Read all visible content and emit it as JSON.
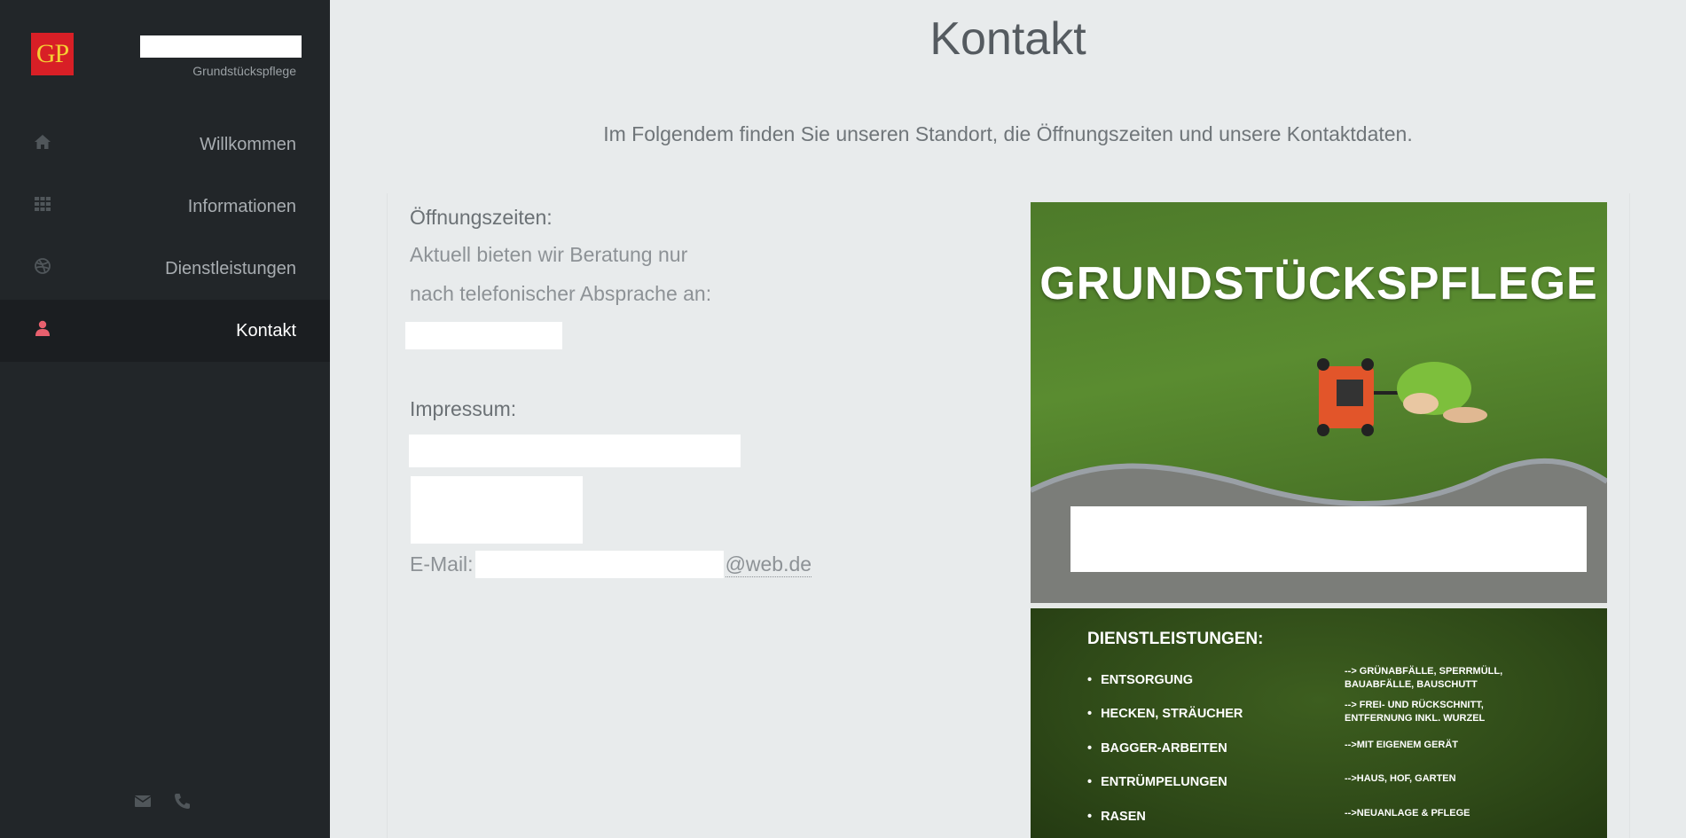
{
  "brand": {
    "logo_text": "GP",
    "subtitle": "Grundstückspflege"
  },
  "nav": [
    {
      "label": "Willkommen",
      "icon": "home-icon"
    },
    {
      "label": "Informationen",
      "icon": "grid-icon"
    },
    {
      "label": "Dienstleistungen",
      "icon": "dribbble-icon"
    },
    {
      "label": "Kontakt",
      "icon": "user-icon",
      "active": true
    }
  ],
  "footer_icons": [
    "envelope-icon",
    "phone-icon"
  ],
  "page": {
    "title": "Kontakt",
    "intro": "Im Folgendem finden Sie unseren Standort, die Öffnungszeiten und unsere Kontaktdaten."
  },
  "contact": {
    "hours_label": "Öffnungszeiten:",
    "hours_line1": "Aktuell bieten wir Beratung nur",
    "hours_line2": "nach telefonischer Absprache an:",
    "impressum_label": "Impressum:",
    "email_label": "E-Mail:",
    "email_domain": "@web.de"
  },
  "flyer": {
    "title": "GRUNDSTÜCKSPFLEGE",
    "services_heading": "DIENSTLEISTUNGEN:",
    "services": [
      {
        "name": "ENTSORGUNG",
        "desc": "--> GRÜNABFÄLLE, SPERRMÜLL, BAUABFÄLLE, BAUSCHUTT"
      },
      {
        "name": "HECKEN, STRÄUCHER",
        "desc": "--> FREI- UND RÜCKSCHNITT, ENTFERNUNG INKL. WURZEL"
      },
      {
        "name": "BAGGER-ARBEITEN",
        "desc": "-->MIT EIGENEM GERÄT"
      },
      {
        "name": "ENTRÜMPELUNGEN",
        "desc": "-->HAUS, HOF, GARTEN"
      },
      {
        "name": "RASEN",
        "desc": "-->NEUANLAGE & PFLEGE"
      }
    ]
  },
  "colors": {
    "sidebar": "#222629",
    "sidebar_active": "#1b1e21",
    "active_icon": "#e8606e",
    "page_bg": "#e8ebec",
    "logo_red": "#d81f26",
    "logo_yellow": "#f5cf33"
  }
}
